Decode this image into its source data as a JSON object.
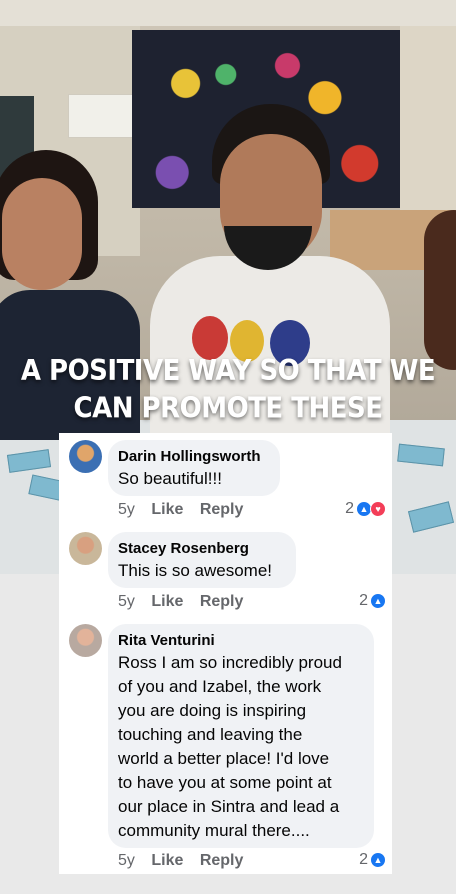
{
  "video": {
    "caption_line1": "A POSITIVE WAY SO THAT WE",
    "caption_line2": "CAN PROMOTE THESE"
  },
  "actions": {
    "like_label": "Like",
    "reply_label": "Reply"
  },
  "comments": [
    {
      "author": "Darin Hollingsworth",
      "text": "So beautiful!!!",
      "age": "5y",
      "reaction_count": "2",
      "reactions": [
        "like-icon",
        "love-icon"
      ]
    },
    {
      "author": "Stacey Rosenberg",
      "text": "This is so awesome!",
      "age": "5y",
      "reaction_count": "2",
      "reactions": [
        "like-icon"
      ]
    },
    {
      "author": "Rita Venturini",
      "text_lines": [
        "Ross I am so incredibly proud",
        "of you and Izabel, the work",
        "you are doing is inspiring",
        "touching and leaving the",
        "world a better place! I'd love",
        "to have you at some point at",
        "our place in Sintra and lead a",
        "community mural there...."
      ],
      "age": "5y",
      "reaction_count": "2",
      "reactions": [
        "like-icon"
      ]
    }
  ],
  "colors": {
    "like_blue": "#1877f2",
    "love_red": "#f33e58",
    "bubble_bg": "#f0f2f5",
    "meta_gray": "#65676b"
  }
}
